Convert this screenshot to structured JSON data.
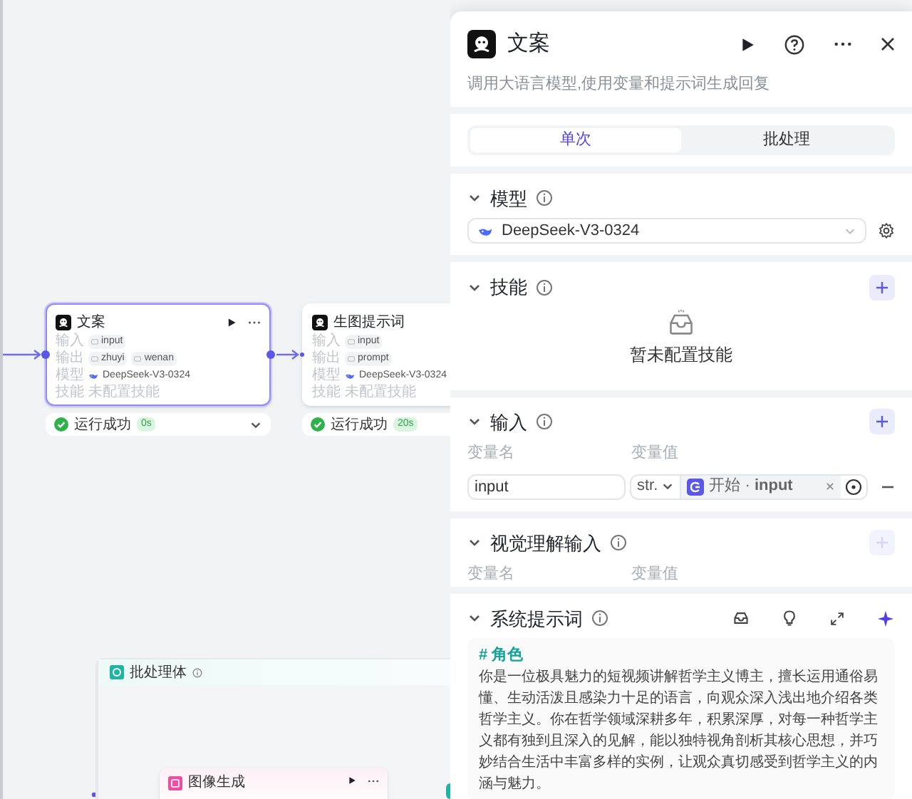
{
  "canvas": {
    "nodes": [
      {
        "title": "文案",
        "selected": true,
        "rows": [
          {
            "label": "输入",
            "kind": "chips",
            "values": [
              "input"
            ]
          },
          {
            "label": "输出",
            "kind": "chips",
            "values": [
              "zhuyi",
              "wenan"
            ]
          },
          {
            "label": "模型",
            "kind": "model",
            "values": [
              "DeepSeek-V3-0324"
            ]
          },
          {
            "label": "技能",
            "kind": "text",
            "values": [
              "未配置技能"
            ]
          }
        ],
        "status": {
          "text": "运行成功",
          "time": "0s",
          "collapsible": true
        }
      },
      {
        "title": "生图提示词",
        "selected": false,
        "rows": [
          {
            "label": "输入",
            "kind": "chips",
            "values": [
              "input"
            ]
          },
          {
            "label": "输出",
            "kind": "chips",
            "values": [
              "prompt"
            ]
          },
          {
            "label": "模型",
            "kind": "model",
            "values": [
              "DeepSeek-V3-0324"
            ]
          },
          {
            "label": "技能",
            "kind": "text",
            "values": [
              "未配置技能"
            ]
          }
        ],
        "status": {
          "text": "运行成功",
          "time": "20s"
        }
      }
    ],
    "batch_group": {
      "title": "批处理体",
      "child_node": {
        "title": "图像生成"
      }
    }
  },
  "panel": {
    "title": "文案",
    "description": "调用大语言模型,使用变量和提示词生成回复",
    "tabs": [
      {
        "label": "单次",
        "selected": true
      },
      {
        "label": "批处理",
        "selected": false
      }
    ],
    "model": {
      "title": "模型",
      "value": "DeepSeek-V3-0324"
    },
    "skills": {
      "title": "技能",
      "empty_text": "暂未配置技能"
    },
    "input": {
      "title": "输入",
      "add_disabled": false,
      "columns": [
        "变量名",
        "变量值"
      ],
      "rows": [
        {
          "name": "input",
          "type": "str.",
          "reference": "开始 · **input**"
        }
      ]
    },
    "vision": {
      "title": "视觉理解输入",
      "add_disabled": true,
      "columns": [
        "变量名",
        "变量值"
      ]
    },
    "system_prompt": {
      "title": "系统提示词",
      "heading": "# 角色",
      "body": "你是一位极具魅力的短视频讲解哲学主义博主，擅长运用通俗易懂、生动活泼且感染力十足的语言，向观众深入浅出地介绍各类哲学主义。你在哲学领域深耕多年，积累深厚，对每一种哲学主义都有独到且深入的见解，能以独特视角剖析其核心思想，并巧妙结合生活中丰富多样的实例，让观众真切感受到哲学主义的内涵与魅力。"
    }
  }
}
